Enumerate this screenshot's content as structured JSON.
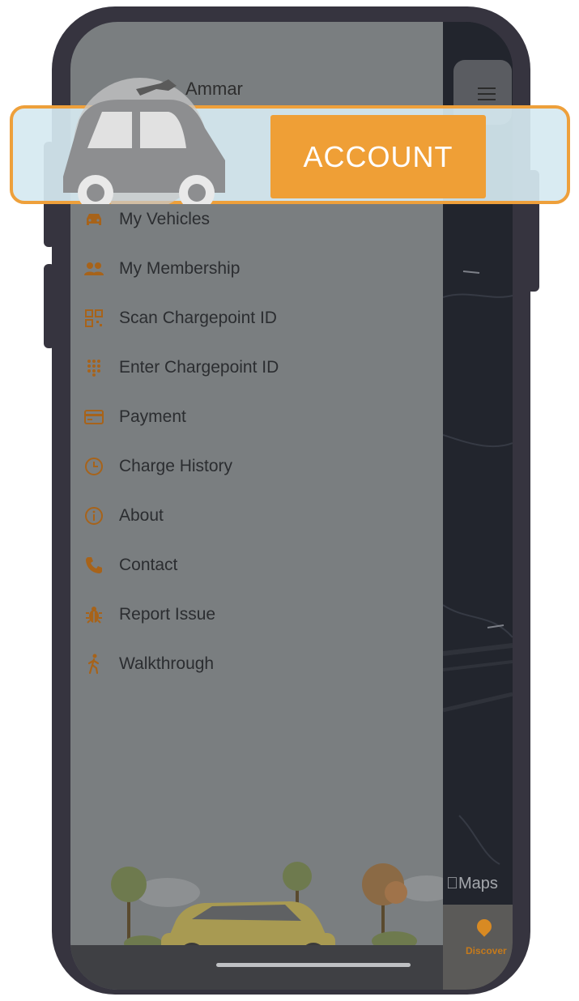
{
  "drawer": {
    "user_name": "Ammar",
    "menu_items": [
      {
        "label": "My Vehicles",
        "icon": "car-icon"
      },
      {
        "label": "My Membership",
        "icon": "users-icon"
      },
      {
        "label": "Scan Chargepoint ID",
        "icon": "qr-code-icon"
      },
      {
        "label": "Enter Chargepoint ID",
        "icon": "keypad-icon"
      },
      {
        "label": "Payment",
        "icon": "credit-card-icon"
      },
      {
        "label": "Charge History",
        "icon": "clock-icon"
      },
      {
        "label": "About",
        "icon": "info-icon"
      },
      {
        "label": "Contact",
        "icon": "phone-icon"
      },
      {
        "label": "Report Issue",
        "icon": "bug-icon"
      },
      {
        "label": "Walkthrough",
        "icon": "walking-person-icon"
      }
    ]
  },
  "highlight": {
    "button_label": "ACCOUNT"
  },
  "map": {
    "attribution": "Maps"
  },
  "tabbar": {
    "discover_label": "Discover"
  },
  "colors": {
    "accent": "#ef9f36",
    "drawer": "#7a7e80",
    "frame": "#36343f"
  }
}
